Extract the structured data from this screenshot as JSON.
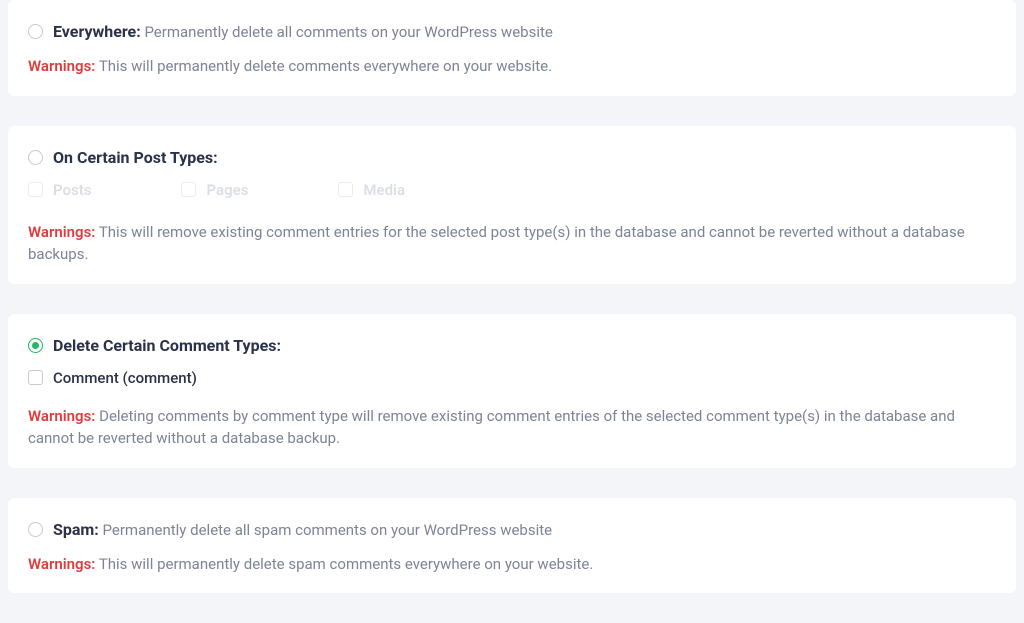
{
  "options": {
    "everywhere": {
      "title": "Everywhere:",
      "desc": "Permanently delete all comments on your WordPress website",
      "warningLabel": "Warnings:",
      "warningText": "This will permanently delete comments everywhere on your website."
    },
    "postTypes": {
      "title": "On Certain Post Types:",
      "items": {
        "posts": "Posts",
        "pages": "Pages",
        "media": "Media"
      },
      "warningLabel": "Warnings:",
      "warningText": "This will remove existing comment entries for the selected post type(s) in the database and cannot be reverted without a database backups."
    },
    "commentTypes": {
      "title": "Delete Certain Comment Types:",
      "items": {
        "comment": "Comment (comment)"
      },
      "warningLabel": "Warnings:",
      "warningText": "Deleting comments by comment type will remove existing comment entries of the selected comment type(s) in the database and cannot be reverted without a database backup."
    },
    "spam": {
      "title": "Spam:",
      "desc": "Permanently delete all spam comments on your WordPress website",
      "warningLabel": "Warnings:",
      "warningText": "This will permanently delete spam comments everywhere on your website."
    }
  }
}
